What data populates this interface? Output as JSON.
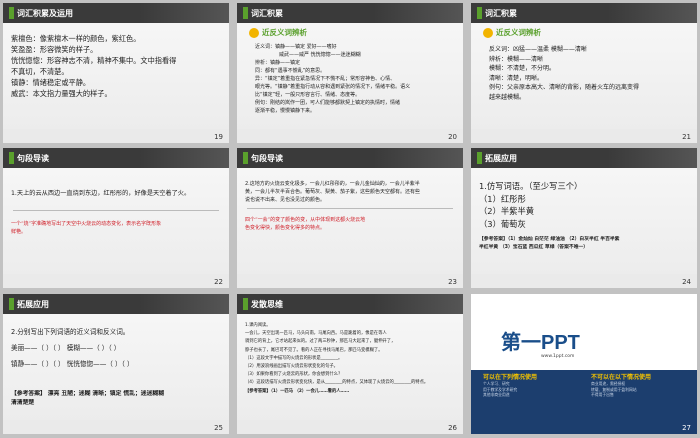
{
  "slides": [
    {
      "num": "19",
      "title": "词汇积累及运用",
      "lines": [
        "紫檀色：像紫檀木一样的颜色，紫红色。",
        "笑盈盈：形容微笑的样子。",
        "恍恍惚惚：形容神志不清，精神不集中。文中指看得",
        "不真切，不清楚。",
        "镇静：情绪稳定或平静。",
        "威武：本文指力量强大的样子。"
      ]
    },
    {
      "num": "20",
      "title": "词汇积累",
      "subhead": "近反义词辨析",
      "lines": [
        "近义词：镇静——镇定    爱好——嗜好",
        "威武——威严    恍恍惚惚——迷迷糊糊",
        "辨析：镇静——镇定",
        "同：都有“遇事不慌乱”的意思。",
        "异：“镇定”着重指在紧急情况下不慌不乱；常形容神色、心情、",
        "眼光等。“镇静”着重指行动从容和遇到紧张的情况下，情绪平稳。语义",
        "比“镇定”轻，一般只形容言行、情绪、态度等。",
        "例句：刚结的岚作一团，可人们能够都默契上镇定的执情时，情绪",
        "逐渐平稳，慢慢镇静下来。"
      ]
    },
    {
      "num": "21",
      "title": "词汇积累",
      "subhead": "近反义词辨析",
      "lines": [
        "反义词：凶猛——温柔    模糊——清晰",
        "辨析：模糊——清晰",
        "模糊：不清楚，不分明。",
        "清晰：清楚，明晰。",
        "例句：父亲原本高大、清晰的背影，随着火车的远离变得",
        "越来越模糊。"
      ]
    },
    {
      "num": "22",
      "title": "句段导读",
      "lines": [
        "1.天上的云从西边一直烧到东边，红彤彤的，好像是天空着了火。"
      ],
      "note": "一个“烧”字准确地写出了天空中火烧云的动态变化，表示名字既形象",
      "note2": "鲜艳。"
    },
    {
      "num": "23",
      "title": "句段导读",
      "lines": [
        "2.这地方的火烧云变化极多，一会儿红彤彤的，一会儿金灿灿的，一会儿半紫半",
        "黄，一会儿半灰半百合色。葡萄灰、梨黄、茄子紫，这些颜色天空都有。还有些",
        "说也说不出来、见也没见过的颜色。"
      ],
      "note": "四个“一会”的变了颜色的变，从中体现到这都火烧云地",
      "note2": "色变化得快，颜色变化得多的特点。"
    },
    {
      "num": "24",
      "title": "拓展应用",
      "lines": [
        "1.仿写词语。（至少写三个）",
        "（1）红彤彤",
        "（2）半紫半黄",
        "（3）葡萄灰"
      ],
      "answer": "【参考答案】（1）金灿灿  白茫茫  绿油油  （2）白灰半红  半百半紫",
      "answer2": "半红半黄  （3）宝石蓝  西瓜红  草绿（答案不唯一）"
    },
    {
      "num": "25",
      "title": "拓展应用",
      "lines": [
        "2.分别写出下列词语的近义词和反义词。",
        "美丽——（      ）（      ）    模糊——（      ）（      ）",
        "镇静——（      ）（      ）    恍恍惚惚——（      ）（      ）"
      ],
      "answer": "【参考答案】  漂亮  丑陋；迷糊  清晰；镇定  慌乱；迷迷糊糊",
      "answer2": "清清楚楚"
    },
    {
      "num": "26",
      "title": "发散思维",
      "lines": [
        "1.课内阅读。",
        "一会儿，天空出现一匹马，马头向南，马尾向西。马是跪着的，像是在等人",
        "骑到它的背上，它才站起来似的。过了两三秒钟，那匹马大起来了，腿伸开了，",
        "脖子也长了，尾巴可不见了。看的人正在寻找马尾巴，那匹马变模糊了。",
        "（1）这段文字中描写的火烧云的形状是________。",
        "（2）用波浪线画出描写火烧云形状变化的句子。",
        "（3）如果你看到了火烧云的形状，你会想到什么？",
        "（4）这段话描写火烧云形状变化快，是从________的特点，又体现了火烧云的________的特点。"
      ],
      "answer": "【参考答案】（1）一匹马 （2）一会儿……看的人……",
      "answer2": ""
    },
    {
      "num": "27",
      "title": "",
      "logo_main": "第一PPT",
      "url": "www.1ppt.com",
      "col1_head": "可以在下列情况使用",
      "col1_items": [
        "个人学习、研究",
        "用于教学及学术研究",
        "其他非商业用途"
      ],
      "col2_head": "不可以在以下情况使用",
      "col2_items": [
        "商业用途，需经授权",
        "转载、复制或用于盈利网站",
        "不得用于出售"
      ]
    }
  ]
}
